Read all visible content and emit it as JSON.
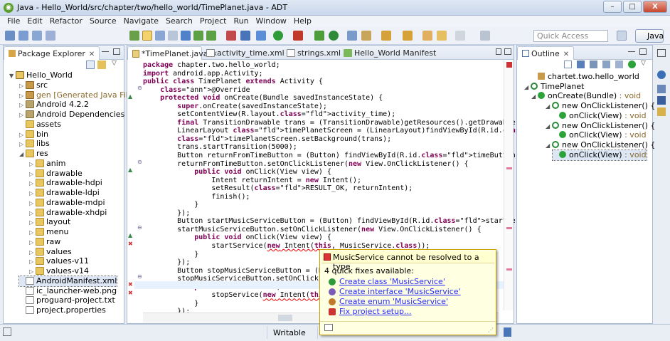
{
  "window": {
    "title": "Java - Hello_World/src/chapter/two/hello_world/TimePlanet.java - ADT",
    "min": "–",
    "max": "□",
    "close": "X"
  },
  "menu": [
    "File",
    "Edit",
    "Refactor",
    "Source",
    "Navigate",
    "Search",
    "Project",
    "Run",
    "Window",
    "Help"
  ],
  "toolbar": {
    "quick_access_placeholder": "Quick Access",
    "perspective": "Java"
  },
  "package_explorer": {
    "title": "Package Explorer",
    "items": [
      {
        "label": "Hello_World",
        "icon": "project-icon"
      },
      {
        "label": "src",
        "icon": "source-folder-icon"
      },
      {
        "label": "gen [Generated Java Files]",
        "icon": "source-folder-icon"
      },
      {
        "label": "Android 4.2.2",
        "icon": "library-icon"
      },
      {
        "label": "Android Dependencies",
        "icon": "library-icon"
      },
      {
        "label": "assets",
        "icon": "folder-icon"
      },
      {
        "label": "bin",
        "icon": "folder-icon"
      },
      {
        "label": "libs",
        "icon": "folder-icon"
      },
      {
        "label": "res",
        "icon": "folder-icon"
      },
      {
        "label": "anim",
        "icon": "folder-icon"
      },
      {
        "label": "drawable",
        "icon": "folder-icon"
      },
      {
        "label": "drawable-hdpi",
        "icon": "folder-icon"
      },
      {
        "label": "drawable-ldpi",
        "icon": "folder-icon"
      },
      {
        "label": "drawable-mdpi",
        "icon": "folder-icon"
      },
      {
        "label": "drawable-xhdpi",
        "icon": "folder-icon"
      },
      {
        "label": "layout",
        "icon": "folder-icon"
      },
      {
        "label": "menu",
        "icon": "folder-icon"
      },
      {
        "label": "raw",
        "icon": "folder-icon"
      },
      {
        "label": "values",
        "icon": "folder-icon"
      },
      {
        "label": "values-v11",
        "icon": "folder-icon"
      },
      {
        "label": "values-v14",
        "icon": "folder-icon"
      },
      {
        "label": "AndroidManifest.xml",
        "icon": "xml-file-icon"
      },
      {
        "label": "ic_launcher-web.png",
        "icon": "image-file-icon"
      },
      {
        "label": "proguard-project.txt",
        "icon": "text-file-icon"
      },
      {
        "label": "project.properties",
        "icon": "text-file-icon"
      }
    ]
  },
  "editor": {
    "tabs": [
      "*TimePlanet.java",
      "activity_time.xml",
      "strings.xml",
      "Hello_World Manifest"
    ],
    "status": "Writable"
  },
  "outline": {
    "title": "Outline",
    "items": [
      {
        "label": "chartet.two.hello_world",
        "ret": ""
      },
      {
        "label": "TimePlanet",
        "ret": ""
      },
      {
        "label": "onCreate(Bundle)",
        "ret": " : void"
      },
      {
        "label": "new OnClickListener() {...}",
        "ret": ""
      },
      {
        "label": "onClick(View)",
        "ret": " : void"
      },
      {
        "label": "new OnClickListener() {...}",
        "ret": ""
      },
      {
        "label": "onClick(View)",
        "ret": " : void"
      },
      {
        "label": "new OnClickListener() {...}",
        "ret": ""
      },
      {
        "label": "onClick(View)",
        "ret": " : void"
      }
    ]
  },
  "quickfix": {
    "title": "MusicService cannot be resolved to a type",
    "count": "4 quick fixes available:",
    "fixes": [
      "Create class 'MusicService'",
      "Create interface 'MusicService'",
      "Create enum 'MusicService'",
      "Fix project setup..."
    ]
  },
  "code": [
    "package chapter.two.hello_world;",
    "import android.app.Activity;",
    "public class TimePlanet extends Activity {",
    "    @Override",
    "    protected void onCreate(Bundle savedInstanceState) {",
    "        super.onCreate(savedInstanceState);",
    "        setContentView(R.layout.activity_time);",
    "        final TransitionDrawable trans = (TransitionDrawable)getResources().getDrawable(R.dr",
    "        LinearLayout timePlanetScreen = (LinearLayout)findViewById(R.id.timePlanetScreen);",
    "        timePlanetScreen.setBackground(trans);",
    "        trans.startTransition(5000);",
    "        Button returnFromTimeButton = (Button) findViewById(R.id.timeButton);",
    "        returnFromTimeButton.setOnClickListener(new View.OnClickListener() {",
    "            public void onClick(View view) {",
    "                Intent returnIntent = new Intent();",
    "                setResult(RESULT_OK, returnIntent);",
    "                finish();",
    "            }",
    "        });",
    "        Button startMusicServiceButton = (Button) findViewById(R.id.startServiceButton);",
    "        startMusicServiceButton.setOnClickListener(new View.OnClickListener() {",
    "            public void onClick(View view) {",
    "                startService(new Intent(this, MusicService.class));",
    "            }",
    "        });",
    "        Button stopMusicServiceButton = (Butt",
    "        stopMusicServiceButton.setOnClickList",
    "            public void onClick(View view) {",
    "                stopService(new Intent(this,",
    "            }",
    "        });"
  ]
}
